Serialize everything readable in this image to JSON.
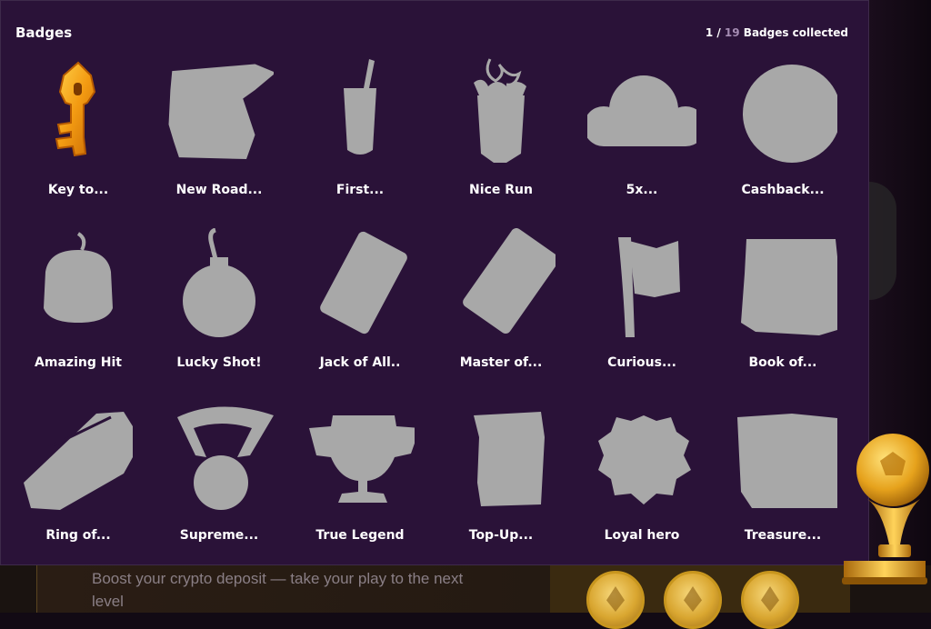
{
  "panel": {
    "title": "Badges",
    "collected": "1",
    "separator": " / ",
    "total": "19",
    "collected_suffix": " Badges collected"
  },
  "badges": [
    {
      "label": "Key to...",
      "icon": "key-icon",
      "unlocked": true
    },
    {
      "label": "New Road...",
      "icon": "road-sign-icon",
      "unlocked": false
    },
    {
      "label": "First...",
      "icon": "drink-cup-icon",
      "unlocked": false
    },
    {
      "label": "Nice Run",
      "icon": "bouquet-icon",
      "unlocked": false
    },
    {
      "label": "5x...",
      "icon": "cloud-icon",
      "unlocked": false
    },
    {
      "label": "Cashback...",
      "icon": "coin-icon",
      "unlocked": false
    },
    {
      "label": "Amazing Hit",
      "icon": "lantern-icon",
      "unlocked": false
    },
    {
      "label": "Lucky Shot!",
      "icon": "bomb-icon",
      "unlocked": false
    },
    {
      "label": "Jack of All..",
      "icon": "card-icon",
      "unlocked": false
    },
    {
      "label": "Master of...",
      "icon": "card-icon",
      "unlocked": false
    },
    {
      "label": "Curious...",
      "icon": "flag-icon",
      "unlocked": false
    },
    {
      "label": "Book of...",
      "icon": "book-icon",
      "unlocked": false
    },
    {
      "label": "Ring of...",
      "icon": "ring-icon",
      "unlocked": false
    },
    {
      "label": "Supreme...",
      "icon": "medal-icon",
      "unlocked": false
    },
    {
      "label": "True Legend",
      "icon": "trophy-cup-icon",
      "unlocked": false
    },
    {
      "label": "Top-Up...",
      "icon": "scroll-icon",
      "unlocked": false
    },
    {
      "label": "Loyal hero",
      "icon": "seal-icon",
      "unlocked": false
    },
    {
      "label": "Treasure...",
      "icon": "treasure-chest-icon",
      "unlocked": false
    }
  ],
  "promo": {
    "text": "Boost your crypto deposit — take your play to the next level"
  },
  "colors": {
    "panel_bg": "#2a1238",
    "silhouette": "#a8a8a8",
    "gold": "#f0a020",
    "total_count": "#a58cb3"
  }
}
